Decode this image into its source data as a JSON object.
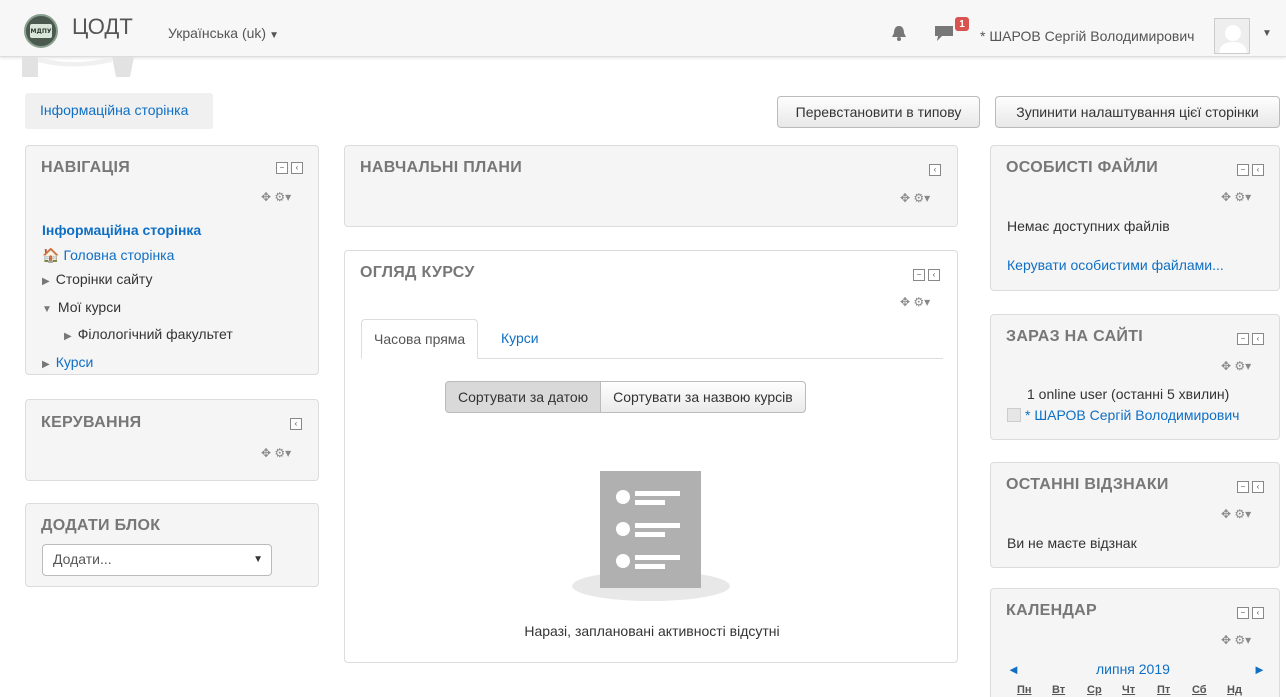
{
  "navbar": {
    "brand": "ЦОДТ",
    "logo_text": "МДПУ",
    "language": "Українська (uk)",
    "notifications_icon": "bell-icon",
    "messages_icon": "speech-bubble-icon",
    "messages_count": "1",
    "user_name": "* ШАРОВ Сергій Володимирович"
  },
  "page": {
    "breadcrumb": "Інформаційна сторінка",
    "reset_button": "Перевстановити в типову",
    "stop_customise_button": "Зупинити налаштування цієї сторінки"
  },
  "navigation": {
    "title": "НАВІГАЦІЯ",
    "current": "Інформаційна сторінка",
    "home": "Головна сторінка",
    "site_pages": "Сторінки сайту",
    "my_courses": "Мої курси",
    "faculty": "Філологічний факультет",
    "courses": "Курси"
  },
  "administration": {
    "title": "КЕРУВАННЯ"
  },
  "add_block": {
    "title": "ДОДАТИ БЛОК",
    "select_value": "Додати..."
  },
  "learning_plans": {
    "title": "НАВЧАЛЬНІ ПЛАНИ"
  },
  "course_overview": {
    "title": "ОГЛЯД КУРСУ",
    "tab_timeline": "Часова пряма",
    "tab_courses": "Курси",
    "sort_by_date": "Сортувати за датою",
    "sort_by_name": "Сортувати за назвою курсів",
    "empty_message": "Наразі, заплановані активності відсутні"
  },
  "private_files": {
    "title": "ОСОБИСТІ ФАЙЛИ",
    "empty": "Немає доступних файлів",
    "manage_link": "Керувати особистими файлами..."
  },
  "online_users": {
    "title": "ЗАРАЗ НА САЙТІ",
    "summary": "1 online user (останні 5 хвилин)",
    "user": "* ШАРОВ Сергій Володимирович"
  },
  "recent_badges": {
    "title": "ОСТАННІ ВІДЗНАКИ",
    "empty": "Ви не маєте відзнак"
  },
  "calendar": {
    "title": "КАЛЕНДАР",
    "prev": "◄",
    "next": "►",
    "month": "липня 2019",
    "days": [
      "Пн",
      "Вт",
      "Ср",
      "Чт",
      "Пт",
      "Сб",
      "Нд"
    ]
  },
  "colors": {
    "link": "#0f6fc5",
    "badge": "#d9534f",
    "block_bg": "#f5f5f5"
  }
}
